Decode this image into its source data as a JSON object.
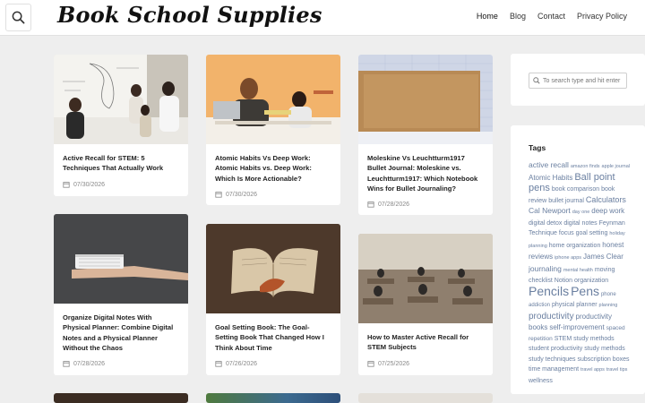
{
  "site": {
    "logo": "Book School Supplies"
  },
  "nav": {
    "home": "Home",
    "blog": "Blog",
    "contact": "Contact",
    "privacy": "Privacy Policy"
  },
  "posts": [
    {
      "title": "Active Recall for STEM: 5 Techniques That Actually Work",
      "date": "07/30/2026"
    },
    {
      "title": "Atomic Habits Vs Deep Work: Atomic Habits vs. Deep Work: Which Is More Actionable?",
      "date": "07/30/2026"
    },
    {
      "title": "Moleskine Vs Leuchtturm1917 Bullet Journal: Moleskine vs. Leuchtturm1917: Which Notebook Wins for Bullet Journaling?",
      "date": "07/28/2026"
    },
    {
      "title": "Organize Digital Notes With Physical Planner: Combine Digital Notes and a Physical Planner Without the Chaos",
      "date": "07/28/2026"
    },
    {
      "title": "Goal Setting Book: The Goal-Setting Book That Changed How I Think About Time",
      "date": "07/26/2026"
    },
    {
      "title": "How to Master Active Recall for STEM Subjects",
      "date": "07/25/2026"
    }
  ],
  "sidebar": {
    "search_placeholder": "To search type and hit enter",
    "tags_title": "Tags",
    "tags": [
      {
        "t": "active recall",
        "s": 8.5
      },
      {
        "t": "amazon finds",
        "s": 5.5
      },
      {
        "t": "apple journal",
        "s": 5.5
      },
      {
        "t": "Atomic Habits",
        "s": 8
      },
      {
        "t": "Ball point pens",
        "s": 11
      },
      {
        "t": "book comparison",
        "s": 7
      },
      {
        "t": "book review",
        "s": 7
      },
      {
        "t": "bullet journal",
        "s": 7
      },
      {
        "t": "Calculators",
        "s": 9
      },
      {
        "t": "Cal Newport",
        "s": 8.5
      },
      {
        "t": "day one",
        "s": 5.5
      },
      {
        "t": "deep work",
        "s": 8
      },
      {
        "t": "digital detox",
        "s": 7
      },
      {
        "t": "digital notes",
        "s": 7
      },
      {
        "t": "Feynman Technique",
        "s": 7
      },
      {
        "t": "focus",
        "s": 7
      },
      {
        "t": "goal setting",
        "s": 7
      },
      {
        "t": "holiday planning",
        "s": 5.5
      },
      {
        "t": "home organization",
        "s": 7
      },
      {
        "t": "honest reviews",
        "s": 8
      },
      {
        "t": "iphone apps",
        "s": 5.5
      },
      {
        "t": "James Clear",
        "s": 8
      },
      {
        "t": "journaling",
        "s": 8.5
      },
      {
        "t": "mental health",
        "s": 5.5
      },
      {
        "t": "moving checklist",
        "s": 7
      },
      {
        "t": "Notion",
        "s": 7
      },
      {
        "t": "organization",
        "s": 7
      },
      {
        "t": "Pencils",
        "s": 14
      },
      {
        "t": "Pens",
        "s": 14
      },
      {
        "t": "phone addiction",
        "s": 6
      },
      {
        "t": "physical planner",
        "s": 7
      },
      {
        "t": "planning",
        "s": 5.5
      },
      {
        "t": "productivity",
        "s": 10
      },
      {
        "t": "productivity books",
        "s": 8
      },
      {
        "t": "self-improvement",
        "s": 8
      },
      {
        "t": "spaced repetition",
        "s": 6.5
      },
      {
        "t": "STEM study methods",
        "s": 7
      },
      {
        "t": "student productivity",
        "s": 7
      },
      {
        "t": "study methods",
        "s": 7
      },
      {
        "t": "study techniques",
        "s": 7
      },
      {
        "t": "subscription boxes",
        "s": 7
      },
      {
        "t": "time management",
        "s": 7
      },
      {
        "t": "travel apps",
        "s": 5.5
      },
      {
        "t": "travel tips",
        "s": 5.5
      },
      {
        "t": "wellness",
        "s": 7
      }
    ]
  },
  "colors": {
    "link": "#6a7fa0",
    "date": "#888888",
    "title": "#222222"
  },
  "icons": {
    "search": "search-icon",
    "calendar": "calendar-icon"
  }
}
